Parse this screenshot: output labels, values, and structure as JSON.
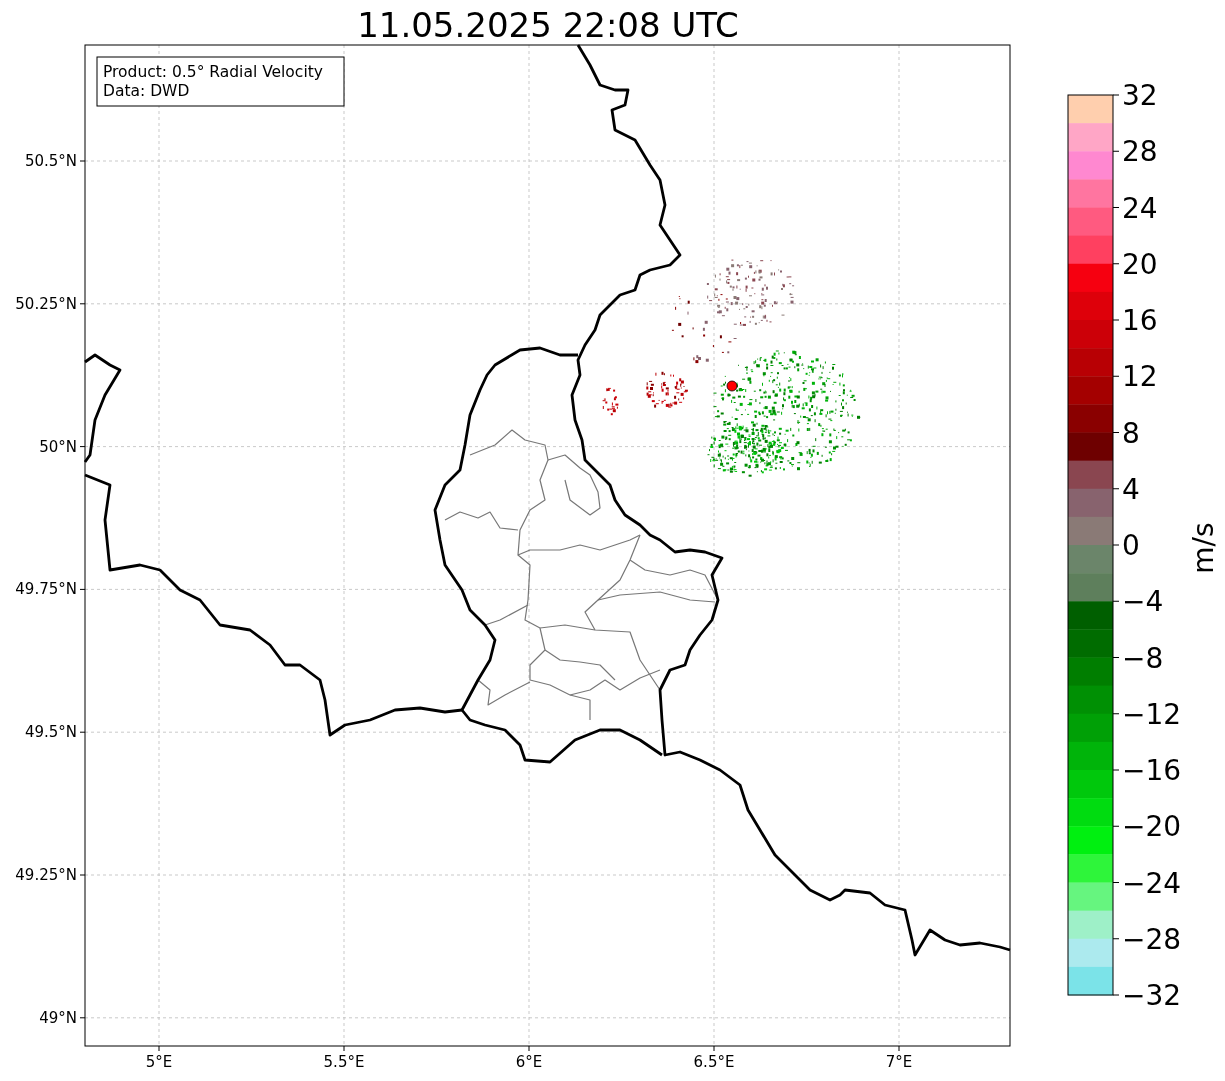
{
  "title": "11.05.2025 22:08 UTC",
  "map": {
    "annotation": [
      "Product: 0.5° Radial Velocity",
      "Data: DWD"
    ],
    "x_ticks": [
      "5°E",
      "5.5°E",
      "6°E",
      "6.5°E",
      "7°E"
    ],
    "y_ticks": [
      "50.5°N",
      "50.25°N",
      "50°N",
      "49.75°N",
      "49.5°N",
      "49.25°N",
      "49°N"
    ]
  },
  "colorbar": {
    "label": "m/s",
    "ticks": [
      "32",
      "28",
      "24",
      "20",
      "16",
      "12",
      "8",
      "4",
      "0",
      "−4",
      "−8",
      "−12",
      "−16",
      "−20",
      "−24",
      "−28",
      "−32"
    ],
    "bands": [
      {
        "color": "#ffcfae"
      },
      {
        "color": "#ffa6c6"
      },
      {
        "color": "#ff88d0"
      },
      {
        "color": "#ff75a0"
      },
      {
        "color": "#ff5a80"
      },
      {
        "color": "#ff4060"
      },
      {
        "color": "#f60010"
      },
      {
        "color": "#de000a"
      },
      {
        "color": "#cc0008"
      },
      {
        "color": "#b80004"
      },
      {
        "color": "#a40000"
      },
      {
        "color": "#8a0000"
      },
      {
        "color": "#6e0000"
      },
      {
        "color": "#8a4650"
      },
      {
        "color": "#88636e"
      },
      {
        "color": "#8a7a76"
      },
      {
        "color": "#6b856a"
      },
      {
        "color": "#5e7f5c"
      },
      {
        "color": "#005f00"
      },
      {
        "color": "#006c00"
      },
      {
        "color": "#007e00"
      },
      {
        "color": "#009004"
      },
      {
        "color": "#00a006"
      },
      {
        "color": "#00b40a"
      },
      {
        "color": "#00c80c"
      },
      {
        "color": "#00dc10"
      },
      {
        "color": "#00f010"
      },
      {
        "color": "#2ef53a"
      },
      {
        "color": "#66f57f"
      },
      {
        "color": "#9ef0c8"
      },
      {
        "color": "#aceaee"
      },
      {
        "color": "#7be3e8"
      }
    ]
  }
}
